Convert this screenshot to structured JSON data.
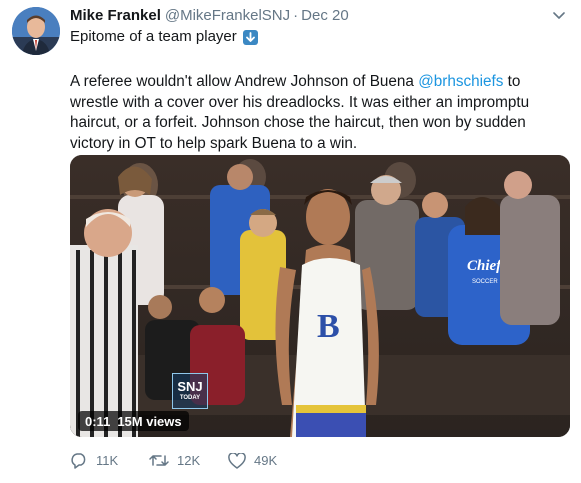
{
  "tweet": {
    "display_name": "Mike Frankel",
    "handle": "@MikeFrankelSNJ",
    "separator": "·",
    "date": "Dec 20",
    "headline": "Epitome of a team player",
    "body_before": "A referee wouldn't allow Andrew Johnson of Buena ",
    "mention": "@brhschiefs",
    "body_after": " to wrestle with a cover over his dreadlocks. It was either an impromptu haircut, or a forfeit. Johnson chose the haircut, then won by sudden victory in OT to help spark Buena to a win."
  },
  "media": {
    "duration": "0:11",
    "views": "15M views",
    "logo_line1": "SNJ",
    "logo_line2": "TODAY",
    "singlet_letter": "B",
    "hoodie_text": "Chiefs",
    "hoodie_subtext": "SOCCER"
  },
  "actions": {
    "reply_count": "11K",
    "retweet_count": "12K",
    "like_count": "49K"
  },
  "icons": {
    "emoji": "down-arrow-icon",
    "reply": "reply-icon",
    "retweet": "retweet-icon",
    "like": "heart-icon",
    "menu": "chevron-down-icon"
  },
  "colors": {
    "link": "#1b95e0",
    "secondary_text": "#657786",
    "emoji_blue": "#3b88c3"
  }
}
